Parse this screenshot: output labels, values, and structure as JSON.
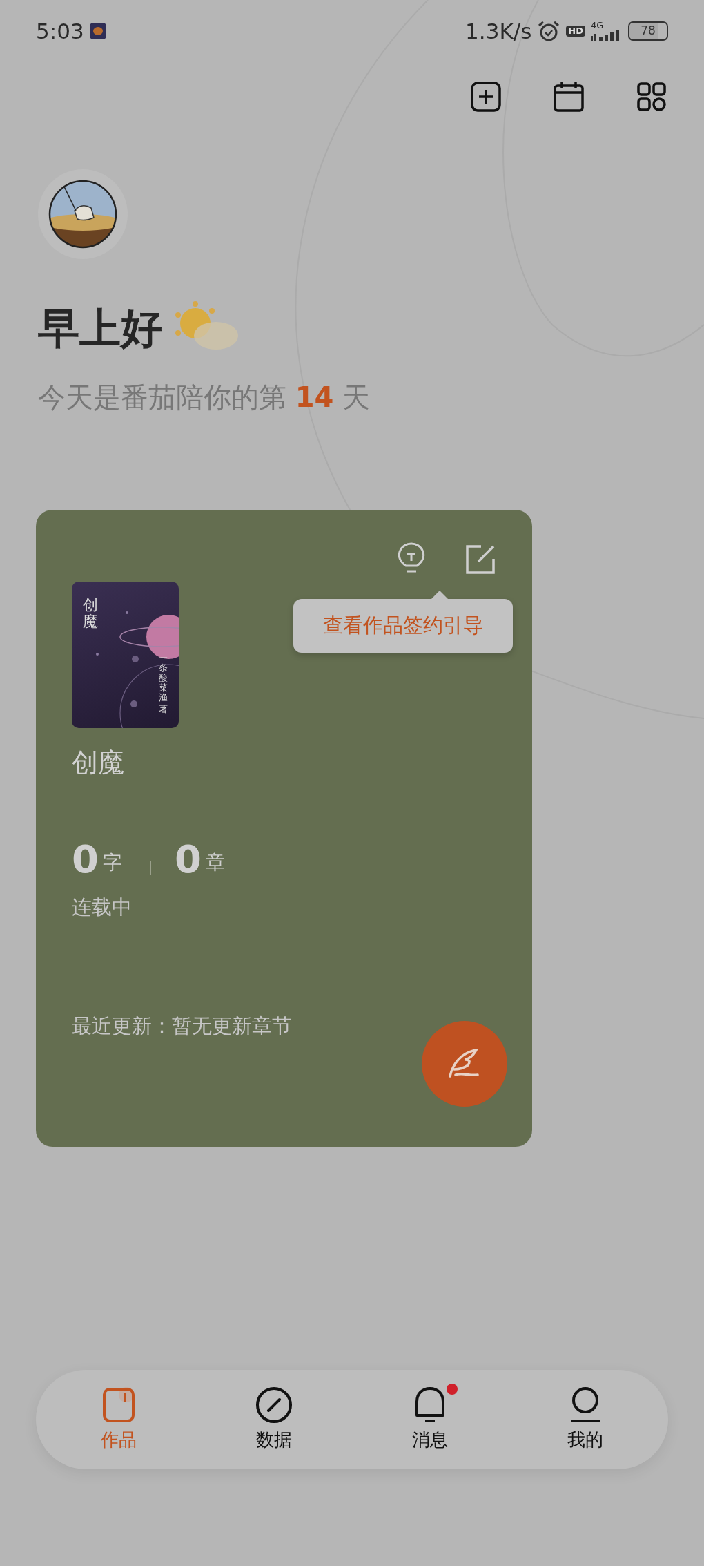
{
  "status_bar": {
    "time": "5:03",
    "net_speed": "1.3K/s",
    "hd": "HD",
    "network": "4G",
    "battery": "78"
  },
  "greeting": {
    "title": "早上好",
    "subtitle_prefix": "今天是番茄陪你的第",
    "days": "14",
    "subtitle_suffix": "天"
  },
  "work_card": {
    "cover": {
      "title": "创魔",
      "author": "一条酸菜渔",
      "by": "著"
    },
    "tooltip": "查看作品签约引导",
    "title": "创魔",
    "stats": [
      {
        "value": "0",
        "unit": "字"
      },
      {
        "value": "0",
        "unit": "章"
      }
    ],
    "status": "连载中",
    "latest_update": "最近更新：暂无更新章节"
  },
  "bottom_nav": [
    {
      "kind": "works",
      "label": "作品",
      "selected": true,
      "badge": false
    },
    {
      "kind": "data",
      "label": "数据",
      "selected": false,
      "badge": false
    },
    {
      "kind": "messages",
      "label": "消息",
      "selected": false,
      "badge": true
    },
    {
      "kind": "profile",
      "label": "我的",
      "selected": false,
      "badge": false
    }
  ]
}
